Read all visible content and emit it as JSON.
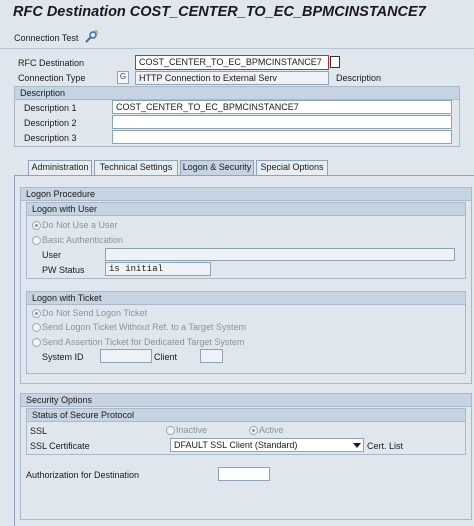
{
  "window": {
    "title": "RFC Destination COST_CENTER_TO_EC_BPMCINSTANCE7"
  },
  "toolbar": {
    "connection_test_label": "Connection Test",
    "icon": "wrench-icon"
  },
  "header": {
    "rfc_destination_label": "RFC Destination",
    "rfc_destination_value": "COST_CENTER_TO_EC_BPMCINSTANCE7",
    "connection_type_label": "Connection Type",
    "connection_type_code": "G",
    "connection_type_desc": "HTTP Connection to External Serv",
    "description_label": "Description"
  },
  "description": {
    "section_title": "Description",
    "desc1_label": "Description 1",
    "desc1_value": "COST_CENTER_TO_EC_BPMCINSTANCE7",
    "desc2_label": "Description 2",
    "desc2_value": "",
    "desc3_label": "Description 3",
    "desc3_value": ""
  },
  "tabs": [
    {
      "label": "Administration",
      "active": false
    },
    {
      "label": "Technical Settings",
      "active": false
    },
    {
      "label": "Logon & Security",
      "active": true
    },
    {
      "label": "Special Options",
      "active": false
    }
  ],
  "logon": {
    "procedure_title": "Logon Procedure",
    "with_user_title": "Logon with User",
    "do_not_use_user": "Do Not Use a User",
    "basic_auth": "Basic Authentication",
    "user_label": "User",
    "user_value": "",
    "pw_status_label": "PW Status",
    "pw_status_value": "is initial",
    "with_ticket_title": "Logon with Ticket",
    "do_not_send_ticket": "Do Not Send Logon Ticket",
    "send_ticket_no_ref": "Send Logon Ticket Without Ref. to a Target System",
    "send_assertion": "Send Assertion Ticket for Dedicated Target System",
    "system_id_label": "System ID",
    "system_id_value": "",
    "client_label": "Client",
    "client_value": ""
  },
  "security": {
    "options_title": "Security Options",
    "secure_protocol_title": "Status of Secure Protocol",
    "ssl_label": "SSL",
    "inactive_label": "Inactive",
    "active_label": "Active",
    "ssl_cert_label": "SSL Certificate",
    "ssl_cert_value": "DFAULT SSL Client (Standard)",
    "cert_list_label": "Cert. List",
    "auth_dest_label": "Authorization for Destination",
    "auth_dest_value": ""
  }
}
